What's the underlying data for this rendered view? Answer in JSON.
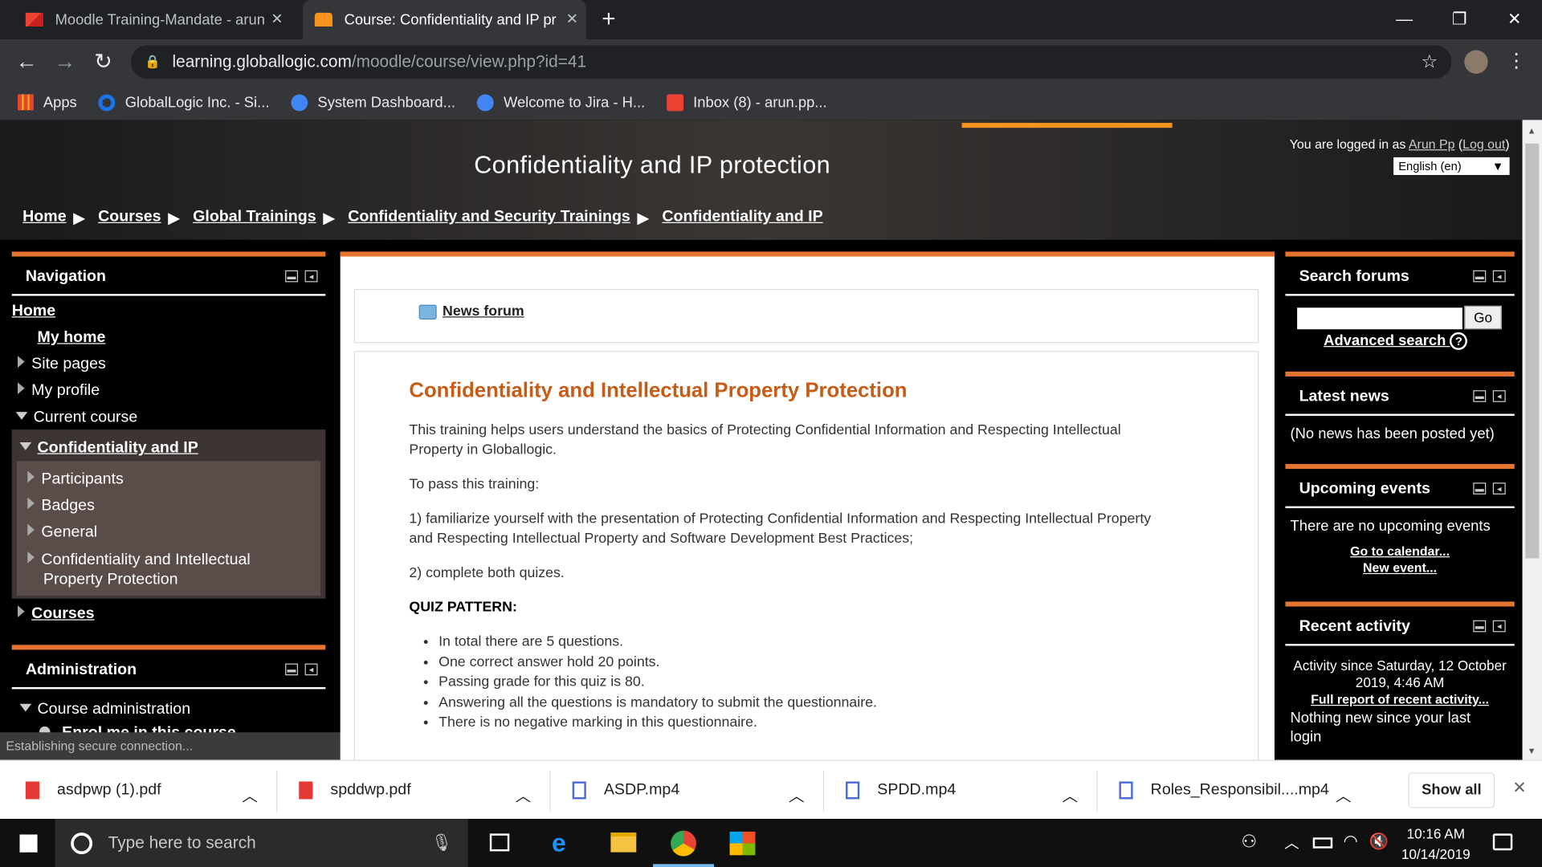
{
  "browser": {
    "tabs": [
      {
        "title": "Moodle Training-Mandate - arun",
        "active": false
      },
      {
        "title": "Course: Confidentiality and IP pr",
        "active": true
      }
    ],
    "url_host": "learning.globallogic.com",
    "url_path": "/moodle/course/view.php?id=41",
    "bookmarks": [
      "Apps",
      "GlobalLogic Inc. - Si...",
      "System Dashboard...",
      "Welcome to Jira - H...",
      "Inbox (8) - arun.pp..."
    ]
  },
  "header": {
    "course_title": "Confidentiality and IP protection",
    "login_prefix": "You are logged in as ",
    "user_name": "Arun Pp",
    "logout": "Log out",
    "language": "English (en)",
    "breadcrumbs": [
      "Home",
      "Courses",
      "Global Trainings",
      "Confidentiality and Security Trainings",
      "Confidentiality and IP"
    ]
  },
  "navigation": {
    "title": "Navigation",
    "home": "Home",
    "my_home": "My home",
    "site_pages": "Site pages",
    "my_profile": "My profile",
    "current_course": "Current course",
    "course_short": "Confidentiality and IP",
    "children": [
      "Participants",
      "Badges",
      "General"
    ],
    "topic_line1": "Confidentiality and Intellectual",
    "topic_line2": "Property Protection",
    "courses": "Courses"
  },
  "administration": {
    "title": "Administration",
    "course_admin": "Course administration",
    "enrol": "Enrol me in this course"
  },
  "status": "Establishing secure connection...",
  "main": {
    "news_forum": "News forum",
    "heading": "Confidentiality and Intellectual Property Protection",
    "intro_l1": "This training helps users understand the basics of Protecting Confidential Information and Respecting Intellectual",
    "intro_l2": "Property in Globallogic.",
    "to_pass": "To pass this training:",
    "step1_l1": "1) familiarize yourself with the presentation of Protecting Confidential Information and Respecting Intellectual Property",
    "step1_l2": "and Respecting Intellectual Property and Software Development Best Practices;",
    "step2": "2) complete both quizes.",
    "quiz_pattern": "QUIZ PATTERN:",
    "rules": [
      "In total there are 5 questions.",
      "One correct answer hold 20 points.",
      "Passing grade for this quiz is 80.",
      "Answering all the questions is mandatory to submit the questionnaire.",
      "There is no negative marking in this questionnaire."
    ]
  },
  "right": {
    "search_title": "Search forums",
    "go": "Go",
    "advanced": "Advanced search",
    "latest_title": "Latest news",
    "latest_body": "(No news has been posted yet)",
    "upcoming_title": "Upcoming events",
    "upcoming_body": "There are no upcoming events",
    "go_calendar": "Go to calendar...",
    "new_event": "New event...",
    "recent_title": "Recent activity",
    "recent_since_l1": "Activity since Saturday, 12 October",
    "recent_since_l2": "2019, 4:46 AM",
    "full_report": "Full report of recent activity...",
    "nothing_l1": "Nothing new since your last",
    "nothing_l2": "login"
  },
  "downloads": [
    {
      "name": "asdpwp (1).pdf",
      "type": "pdf"
    },
    {
      "name": "spddwp.pdf",
      "type": "pdf"
    },
    {
      "name": "ASDP.mp4",
      "type": "video"
    },
    {
      "name": "SPDD.mp4",
      "type": "video"
    },
    {
      "name": "Roles_Responsibil....mp4",
      "type": "video"
    }
  ],
  "show_all": "Show all",
  "taskbar": {
    "search_placeholder": "Type here to search",
    "time": "10:16 AM",
    "date": "10/14/2019"
  }
}
